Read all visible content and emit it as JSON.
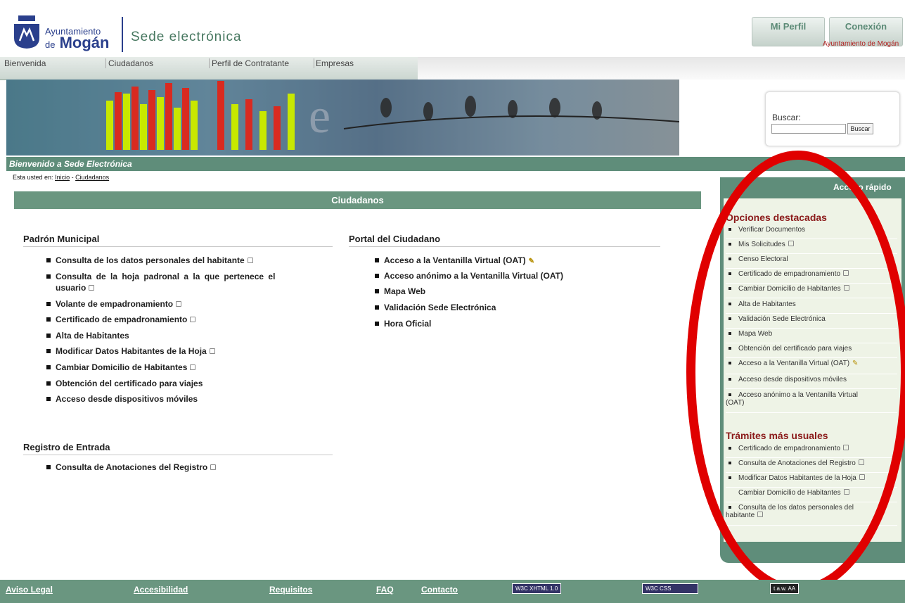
{
  "header": {
    "logo_line1": "Ayuntamiento",
    "logo_de": "de",
    "logo_line2": "Mogán",
    "site_title": "Sede electrónica",
    "profile_button": "Mi Perfil",
    "login_button": "Conexión",
    "org_name": "Ayuntamiento de Mogán"
  },
  "nav": {
    "items": [
      "Bienvenida",
      "Ciudadanos",
      "Perfil de Contratante",
      "Empresas"
    ]
  },
  "search": {
    "label": "Buscar:",
    "button": "Buscar"
  },
  "welcome": "Bienvenido a Sede Electrónica",
  "breadcrumb": {
    "prefix": "Esta usted en:",
    "items": [
      "Inicio",
      "Ciudadanos"
    ],
    "separator": "-"
  },
  "main": {
    "title": "Ciudadanos",
    "padron": {
      "heading": "Padrón Municipal",
      "items": [
        "Consulta de los datos personales del habitante",
        "Consulta de la hoja padronal a la que pertenece el",
        "usuario",
        "Volante de empadronamiento",
        "Certificado de empadronamiento",
        "Alta de Habitantes",
        "Modificar Datos Habitantes de la Hoja",
        "Cambiar Domicilio de Habitantes",
        "Obtención del certificado para viajes",
        "Acceso desde dispositivos móviles"
      ]
    },
    "portal": {
      "heading": "Portal del Ciudadano",
      "items": [
        "Acceso a la Ventanilla Virtual (OAT)",
        "Acceso anónimo a la Ventanilla Virtual (OAT)",
        "Mapa Web",
        "Validación Sede Electrónica",
        "Hora Oficial"
      ]
    },
    "registro": {
      "heading": "Registro de Entrada",
      "items": [
        "Consulta de Anotaciones del Registro"
      ]
    }
  },
  "quick_access": {
    "title": "Acceso rápido",
    "featured_heading": "Opciones destacadas",
    "featured": [
      "Verificar Documentos",
      "Mis Solicitudes",
      "Censo Electoral",
      "Certificado de empadronamiento",
      "Cambiar Domicilio de Habitantes",
      "Alta de Habitantes",
      "Validación Sede Electrónica",
      "Mapa Web",
      "Obtención del certificado para viajes",
      "Acceso a la Ventanilla Virtual (OAT)",
      "Acceso desde dispositivos móviles",
      "Acceso anónimo a la Ventanilla Virtual",
      "(OAT)"
    ],
    "usual_heading": "Trámites más usuales",
    "usual": [
      "Certificado de empadronamiento",
      "Consulta de Anotaciones del Registro",
      "Modificar Datos Habitantes de la Hoja",
      "Cambiar Domicilio de Habitantes",
      "Consulta de los datos personales del",
      "habitante"
    ]
  },
  "footer": {
    "links": [
      "Aviso Legal",
      "Accesibilidad",
      "Requisitos",
      "FAQ",
      "Contacto"
    ],
    "badge_xhtml": "W3C XHTML 1.0",
    "badge_css": "W3C CSS",
    "badge_taw": "t.a.w. AA"
  },
  "colors": {
    "green_bar": "#6a9680",
    "accent_red": "#8b1a1a",
    "annotation_circle": "#e00000"
  }
}
